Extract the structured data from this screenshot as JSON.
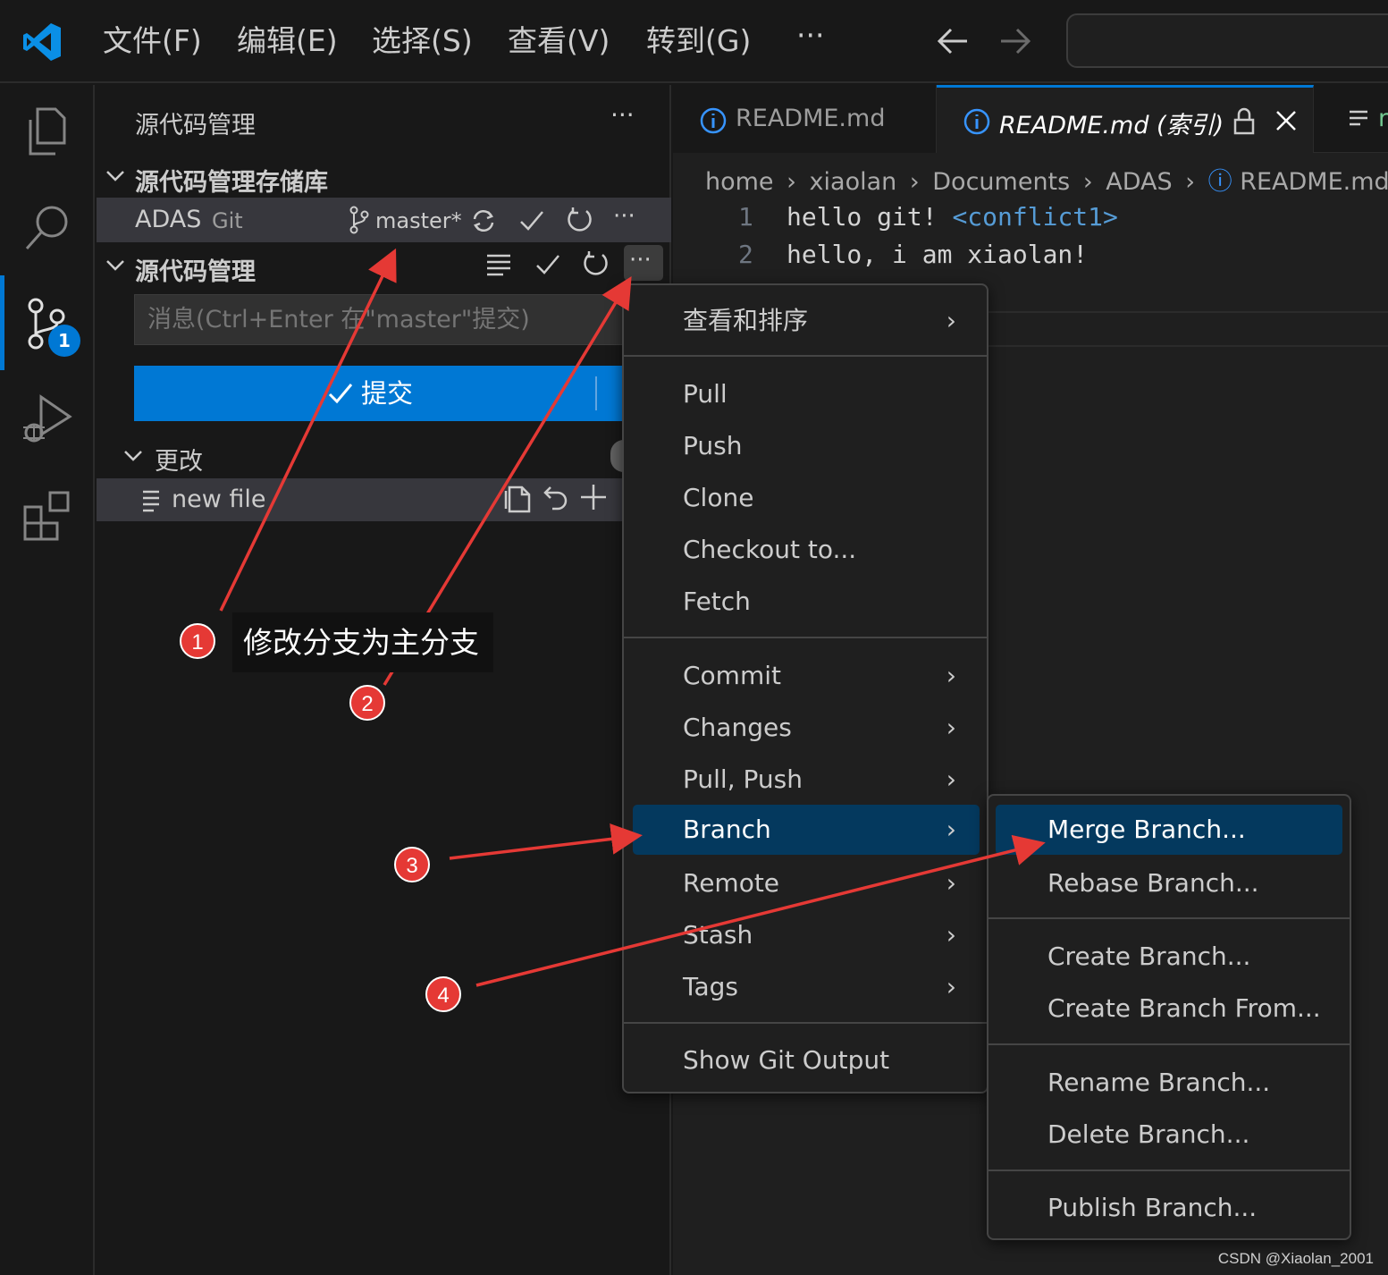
{
  "titlebar": {
    "menu": [
      "文件(F)",
      "编辑(E)",
      "选择(S)",
      "查看(V)",
      "转到(G)",
      "···"
    ]
  },
  "activitybar": {
    "badge": "1"
  },
  "sidebar": {
    "title": "源代码管理",
    "repos_header": "源代码管理存储库",
    "repo_name": "ADAS",
    "repo_type": "Git",
    "branch": "master*",
    "scm_header": "源代码管理",
    "message_placeholder": "消息(Ctrl+Enter 在\"master\"提交)",
    "commit_label": "提交",
    "changes_header": "更改",
    "file_name": "new file"
  },
  "editor": {
    "tab1": "README.md",
    "tab2": "README.md (索引)",
    "tab3": "r",
    "breadcrumb": [
      "home",
      "xiaolan",
      "Documents",
      "ADAS",
      "README.md"
    ],
    "lines": [
      {
        "num": "1",
        "text": "hello git! ",
        "tag": "<conflict1>"
      },
      {
        "num": "2",
        "text": "hello, i am xiaolan!",
        "tag": ""
      }
    ]
  },
  "menu1": {
    "items": [
      "查看和排序",
      "Pull",
      "Push",
      "Clone",
      "Checkout to...",
      "Fetch",
      "Commit",
      "Changes",
      "Pull, Push",
      "Branch",
      "Remote",
      "Stash",
      "Tags",
      "Show Git Output"
    ]
  },
  "menu2": {
    "items": [
      "Merge Branch...",
      "Rebase Branch...",
      "Create Branch...",
      "Create Branch From...",
      "Rename Branch...",
      "Delete Branch...",
      "Publish Branch..."
    ]
  },
  "annotations": {
    "callout": "修改分支为主分支",
    "steps": [
      "1",
      "2",
      "3",
      "4"
    ]
  },
  "watermark": "CSDN @Xiaolan_2001",
  "colors": {
    "accent": "#0078d4",
    "annotation": "#e53935",
    "selection": "#04395e"
  }
}
